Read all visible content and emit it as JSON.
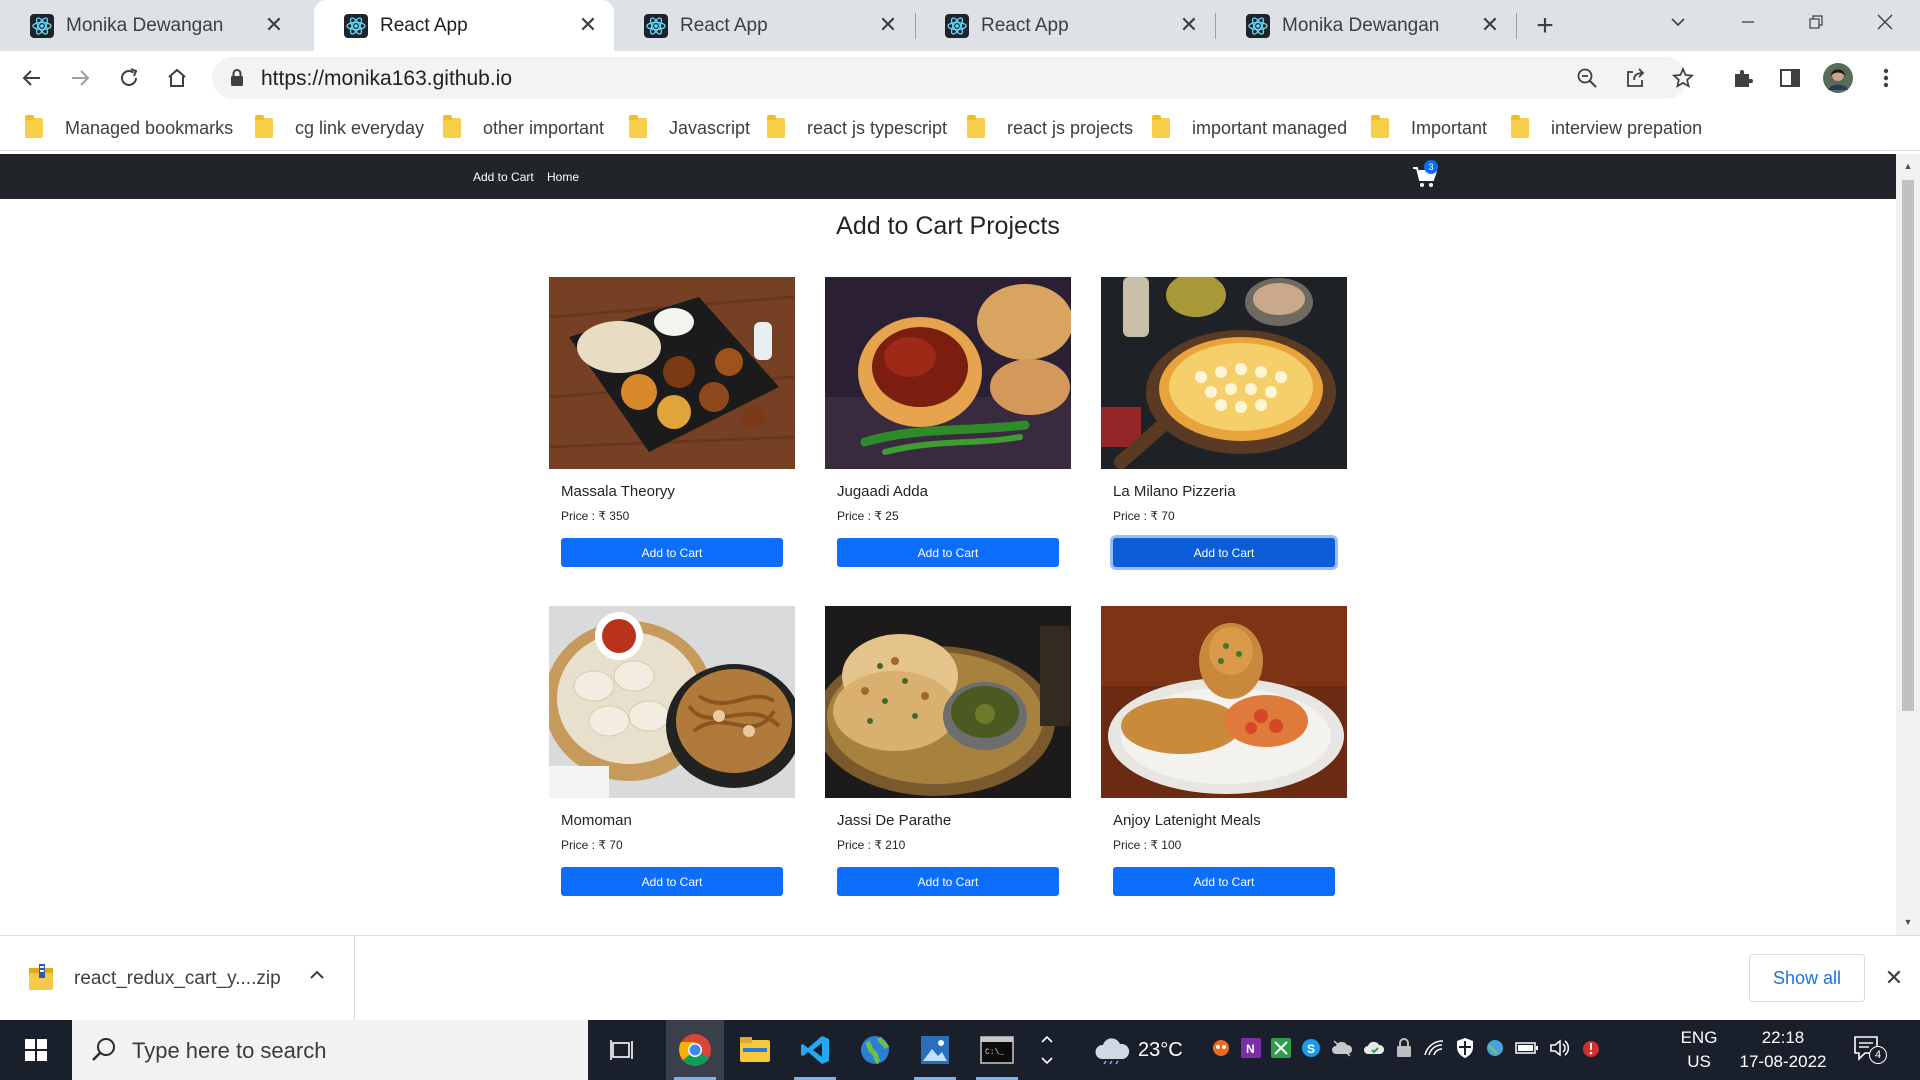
{
  "browser": {
    "tabs": [
      {
        "title": "Monika Dewangan",
        "active": false
      },
      {
        "title": "React App",
        "active": true
      },
      {
        "title": "React App",
        "active": false
      },
      {
        "title": "React App",
        "active": false
      },
      {
        "title": "Monika Dewangan",
        "active": false
      }
    ],
    "url": "https://monika163.github.io",
    "bookmarks": [
      "Managed bookmarks",
      "cg link everyday",
      "other important",
      "Javascript",
      "react js typescript",
      "react js projects",
      "important managed",
      "Important",
      "interview prepation"
    ]
  },
  "site": {
    "nav": {
      "add_to_cart": "Add to Cart",
      "home": "Home"
    },
    "cart_count": "3",
    "title": "Add to Cart Projects",
    "products": [
      {
        "name": "Massala Theoryy",
        "price": "Price : ₹ 350",
        "button": "Add to Cart"
      },
      {
        "name": "Jugaadi Adda",
        "price": "Price : ₹ 25",
        "button": "Add to Cart"
      },
      {
        "name": "La Milano Pizzeria",
        "price": "Price : ₹ 70",
        "button": "Add to Cart"
      },
      {
        "name": "Momoman",
        "price": "Price : ₹ 70",
        "button": "Add to Cart"
      },
      {
        "name": "Jassi De Parathe",
        "price": "Price : ₹ 210",
        "button": "Add to Cart"
      },
      {
        "name": "Anjoy Latenight Meals",
        "price": "Price : ₹ 100",
        "button": "Add to Cart"
      }
    ]
  },
  "downloads": {
    "file": "react_redux_cart_y....zip",
    "show_all": "Show all"
  },
  "taskbar": {
    "search_placeholder": "Type here to search",
    "weather": "23°C",
    "lang_top": "ENG",
    "lang_bottom": "US",
    "time": "22:18",
    "date": "17-08-2022",
    "notifications": "4"
  },
  "colors": {
    "nav_bg": "#212529",
    "button_primary": "#0d6efd",
    "taskbar_bg": "#1a1f2c"
  }
}
